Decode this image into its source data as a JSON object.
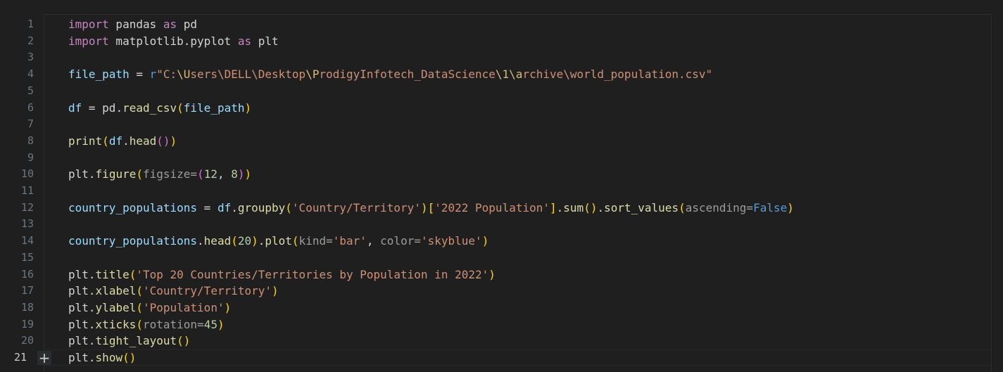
{
  "editor": {
    "line_numbers": [
      "1",
      "2",
      "3",
      "4",
      "5",
      "6",
      "7",
      "8",
      "9",
      "10",
      "11",
      "12",
      "13",
      "14",
      "15",
      "16",
      "17",
      "18",
      "19",
      "20",
      "21"
    ],
    "active_line": "21",
    "add_cell_symbol": "+"
  },
  "code": {
    "l1": {
      "kw_import": "import",
      "mod": " pandas ",
      "kw_as": "as",
      "alias": " pd"
    },
    "l2": {
      "kw_import": "import",
      "mod": " matplotlib.pyplot ",
      "kw_as": "as",
      "alias": " plt"
    },
    "l4": {
      "var": "file_path",
      "eq": " = ",
      "prefix": "r",
      "str_a": "\"C:",
      "esc1": "\\U",
      "str_b": "sers\\DELL\\Desktop",
      "esc2": "\\P",
      "str_c": "rodigyInfotech_DataScience",
      "esc3": "\\1",
      "esc4": "\\a",
      "str_d": "rchive\\world_population.csv\""
    },
    "l6": {
      "var": "df",
      "eq": " = ",
      "obj": "pd",
      "dot": ".",
      "fn": "read_csv",
      "open": "(",
      "arg": "file_path",
      "close": ")"
    },
    "l8": {
      "fn": "print",
      "open": "(",
      "obj": "df",
      "dot": ".",
      "fn2": "head",
      "open2": "(",
      "close2": ")",
      "close": ")"
    },
    "l10": {
      "obj": "plt",
      "dot": ".",
      "fn": "figure",
      "open": "(",
      "param": "figsize",
      "eq": "=",
      "open2": "(",
      "n1": "12",
      "comma": ", ",
      "n2": "8",
      "close2": ")",
      "close": ")"
    },
    "l12": {
      "var": "country_populations",
      "eq": " = ",
      "obj": "df",
      "dot": ".",
      "fn": "groupby",
      "open": "(",
      "s1": "'Country/Territory'",
      "close": ")",
      "lb": "[",
      "s2": "'2022 Population'",
      "rb": "]",
      "dot2": ".",
      "fn2": "sum",
      "open2": "(",
      "close2": ")",
      "dot3": ".",
      "fn3": "sort_values",
      "open3": "(",
      "param": "ascending",
      "eq2": "=",
      "const": "False",
      "close3": ")"
    },
    "l14": {
      "var": "country_populations",
      "dot": ".",
      "fn": "head",
      "open": "(",
      "n": "20",
      "close": ")",
      "dot2": ".",
      "fn2": "plot",
      "open2": "(",
      "param1": "kind",
      "eq1": "=",
      "s1": "'bar'",
      "comma": ", ",
      "param2": "color",
      "eq2": "=",
      "s2": "'skyblue'",
      "close2": ")"
    },
    "l16": {
      "obj": "plt",
      "dot": ".",
      "fn": "title",
      "open": "(",
      "s": "'Top 20 Countries/Territories by Population in 2022'",
      "close": ")"
    },
    "l17": {
      "obj": "plt",
      "dot": ".",
      "fn": "xlabel",
      "open": "(",
      "s": "'Country/Territory'",
      "close": ")"
    },
    "l18": {
      "obj": "plt",
      "dot": ".",
      "fn": "ylabel",
      "open": "(",
      "s": "'Population'",
      "close": ")"
    },
    "l19": {
      "obj": "plt",
      "dot": ".",
      "fn": "xticks",
      "open": "(",
      "param": "rotation",
      "eq": "=",
      "n": "45",
      "close": ")"
    },
    "l20": {
      "obj": "plt",
      "dot": ".",
      "fn": "tight_layout",
      "open": "(",
      "close": ")"
    },
    "l21": {
      "obj": "plt",
      "dot": ".",
      "fn": "show",
      "open": "(",
      "close": ")"
    }
  }
}
